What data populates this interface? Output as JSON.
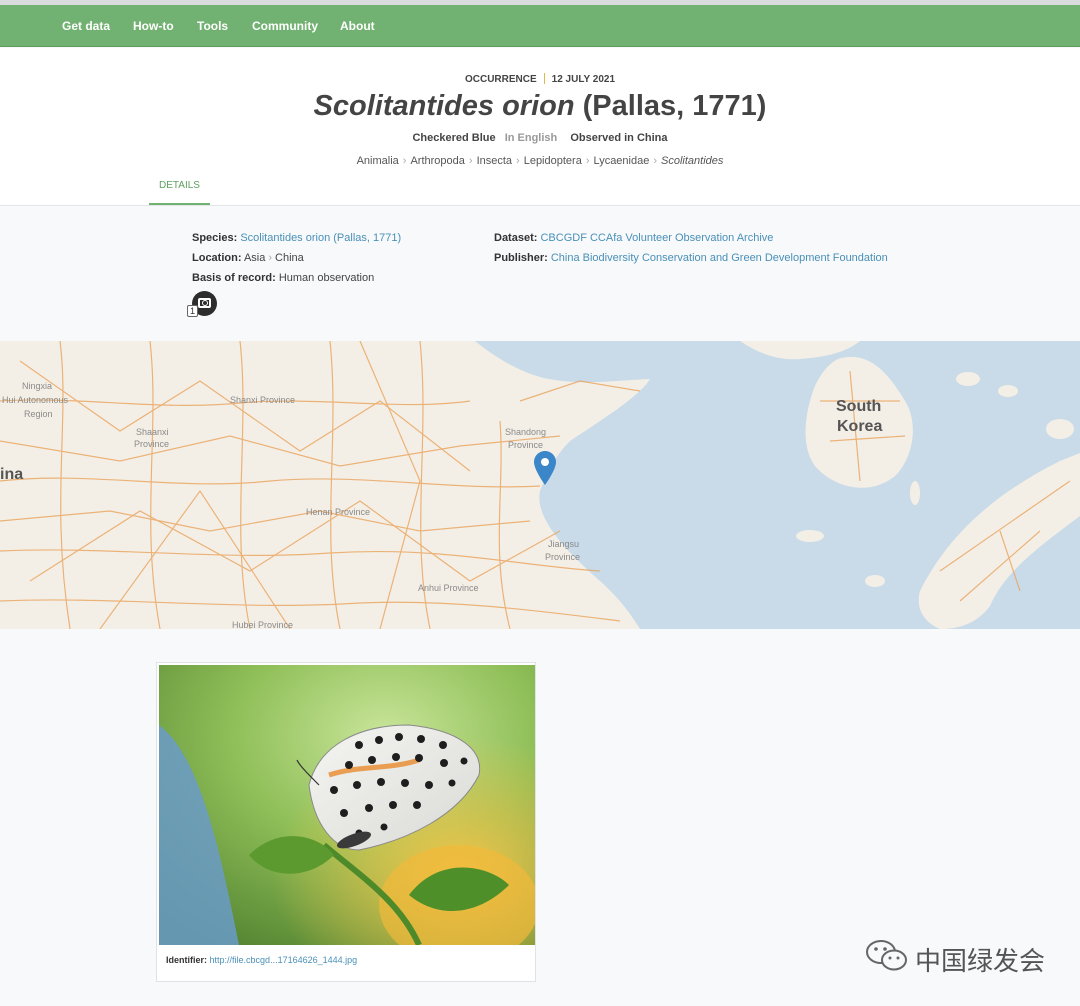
{
  "nav": {
    "items": [
      "Get data",
      "How-to",
      "Tools",
      "Community",
      "About"
    ],
    "color": "#71b171"
  },
  "header": {
    "kicker_type": "OCCURRENCE",
    "kicker_date": "12 JULY 2021",
    "title_italic": "Scolitantides orion",
    "title_author": "(Pallas, 1771)",
    "common_name": "Checkered Blue",
    "language_note": "In English",
    "observed": "Observed in China",
    "taxonomy": [
      "Animalia",
      "Arthropoda",
      "Insecta",
      "Lepidoptera",
      "Lycaenidae"
    ],
    "genus": "Scolitantides",
    "tab": "DETAILS"
  },
  "details": {
    "species_label": "Species:",
    "species_value": "Scolitantides orion (Pallas, 1771)",
    "location_label": "Location:",
    "location_continent": "Asia",
    "location_country": "China",
    "basis_label": "Basis of record:",
    "basis_value": "Human observation",
    "dataset_label": "Dataset:",
    "dataset_value": "CBCGDF CCAfa Volunteer Observation Archive",
    "publisher_label": "Publisher:",
    "publisher_value": "China Biodiversity Conservation and Green Development Foundation",
    "photo_count": "1"
  },
  "map": {
    "labels": [
      "Ningxia",
      "Hui Autonomous",
      "Region",
      "Shanxi Province",
      "Shaanxi",
      "Province",
      "Shandong",
      "Province",
      "Henan Province",
      "Jiangsu",
      "Province",
      "Anhui Province",
      "Hubei Province",
      "ina",
      "South",
      "Korea"
    ],
    "land_color": "#f4efe6",
    "sea_color": "#c9dbe9",
    "road_color": "#e9a35d",
    "marker_color": "#3a86c8"
  },
  "gallery": {
    "identifier_label": "Identifier:",
    "identifier_value": "http://file.cbcgd...17164626_1444.jpg"
  },
  "watermark": {
    "text": "中国绿发会"
  }
}
